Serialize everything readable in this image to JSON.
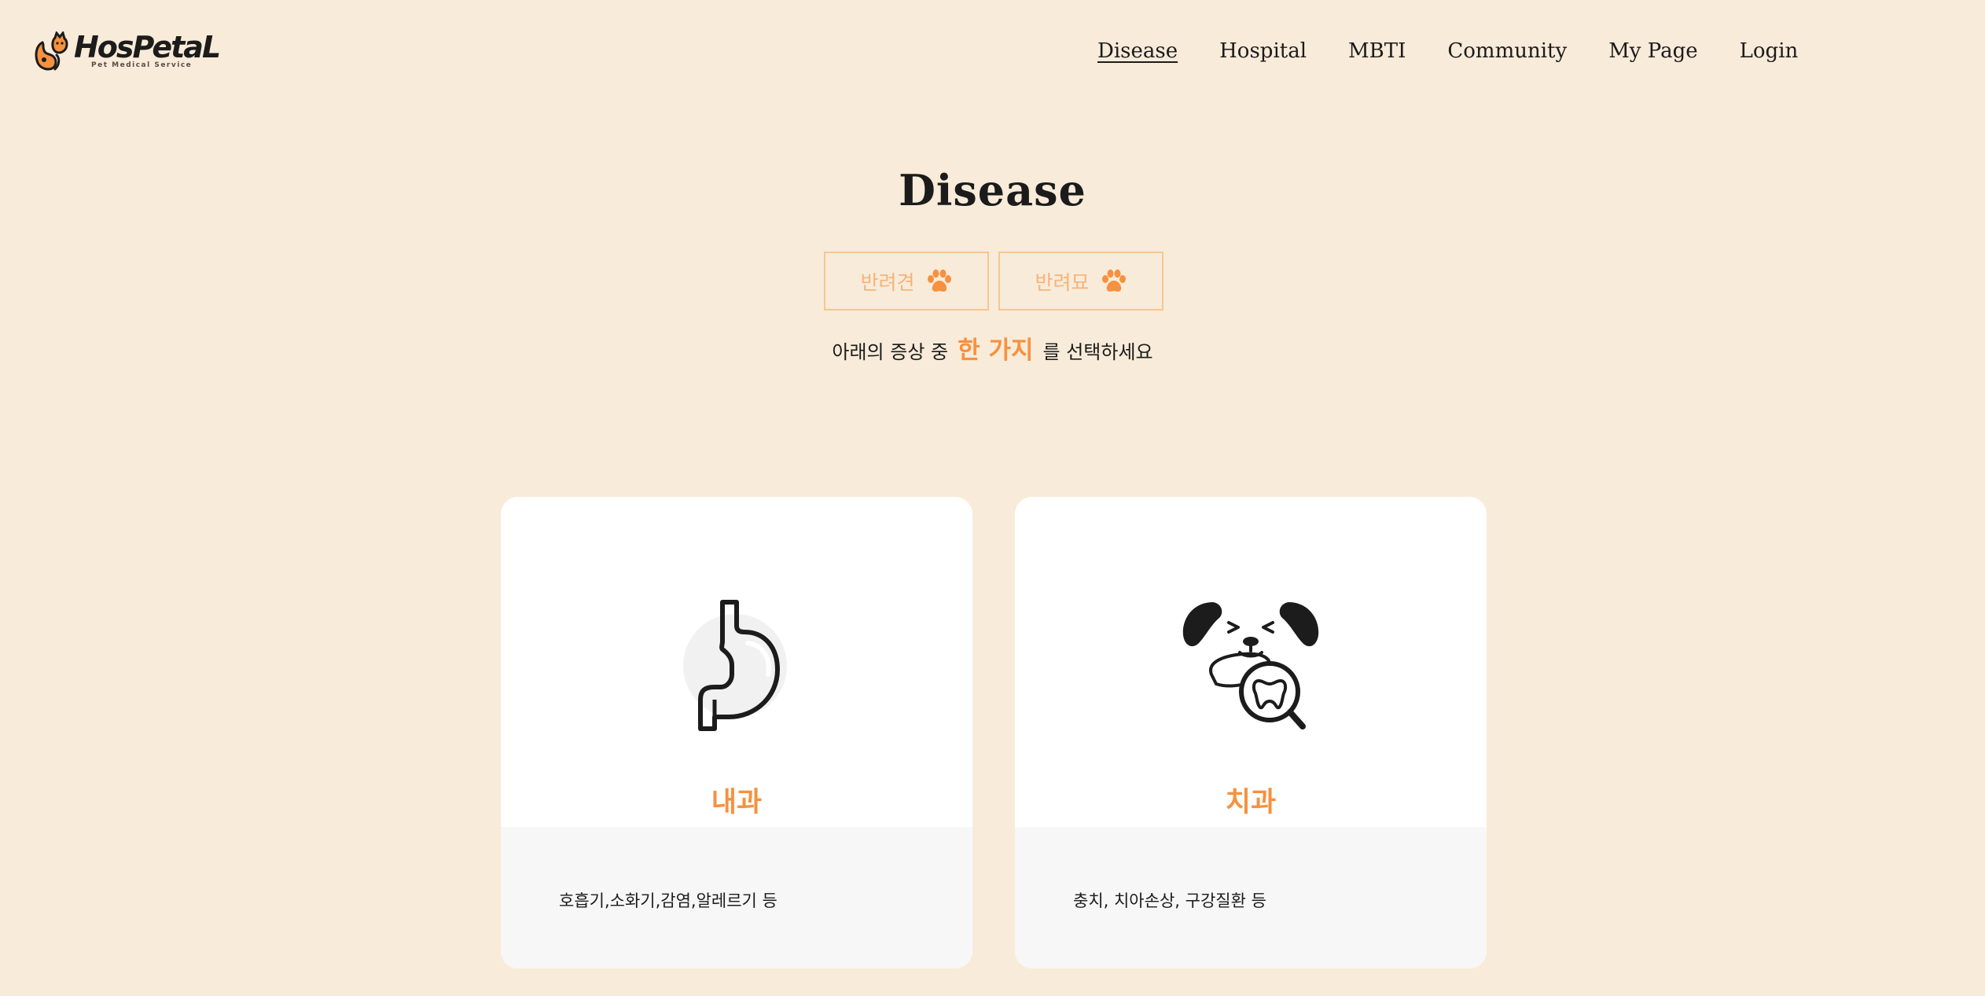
{
  "brand": {
    "name": "HosPetaL",
    "tagline": "Pet Medical Service"
  },
  "nav": {
    "items": [
      {
        "label": "Disease",
        "active": true
      },
      {
        "label": "Hospital",
        "active": false
      },
      {
        "label": "MBTI",
        "active": false
      },
      {
        "label": "Community",
        "active": false
      },
      {
        "label": "My Page",
        "active": false
      },
      {
        "label": "Login",
        "active": false
      }
    ]
  },
  "page": {
    "title": "Disease"
  },
  "pet_toggle": {
    "options": [
      {
        "label": "반려견",
        "icon": "paw-icon"
      },
      {
        "label": "반려묘",
        "icon": "paw-icon"
      }
    ]
  },
  "instruction": {
    "before": "아래의 증상 중",
    "highlight": "한 가지",
    "after": "를 선택하세요"
  },
  "cards": [
    {
      "title": "내과",
      "description": "호흡기,소화기,감염,알레르기 등",
      "icon": "stomach-icon"
    },
    {
      "title": "치과",
      "description": "충치, 치아손상, 구강질환 등",
      "icon": "dog-tooth-icon"
    }
  ],
  "colors": {
    "background": "#f8ebd9",
    "accent": "#f6913f",
    "toggle_border": "#f7c68e",
    "card": "#ffffff",
    "card_footer": "#f7f7f7"
  }
}
